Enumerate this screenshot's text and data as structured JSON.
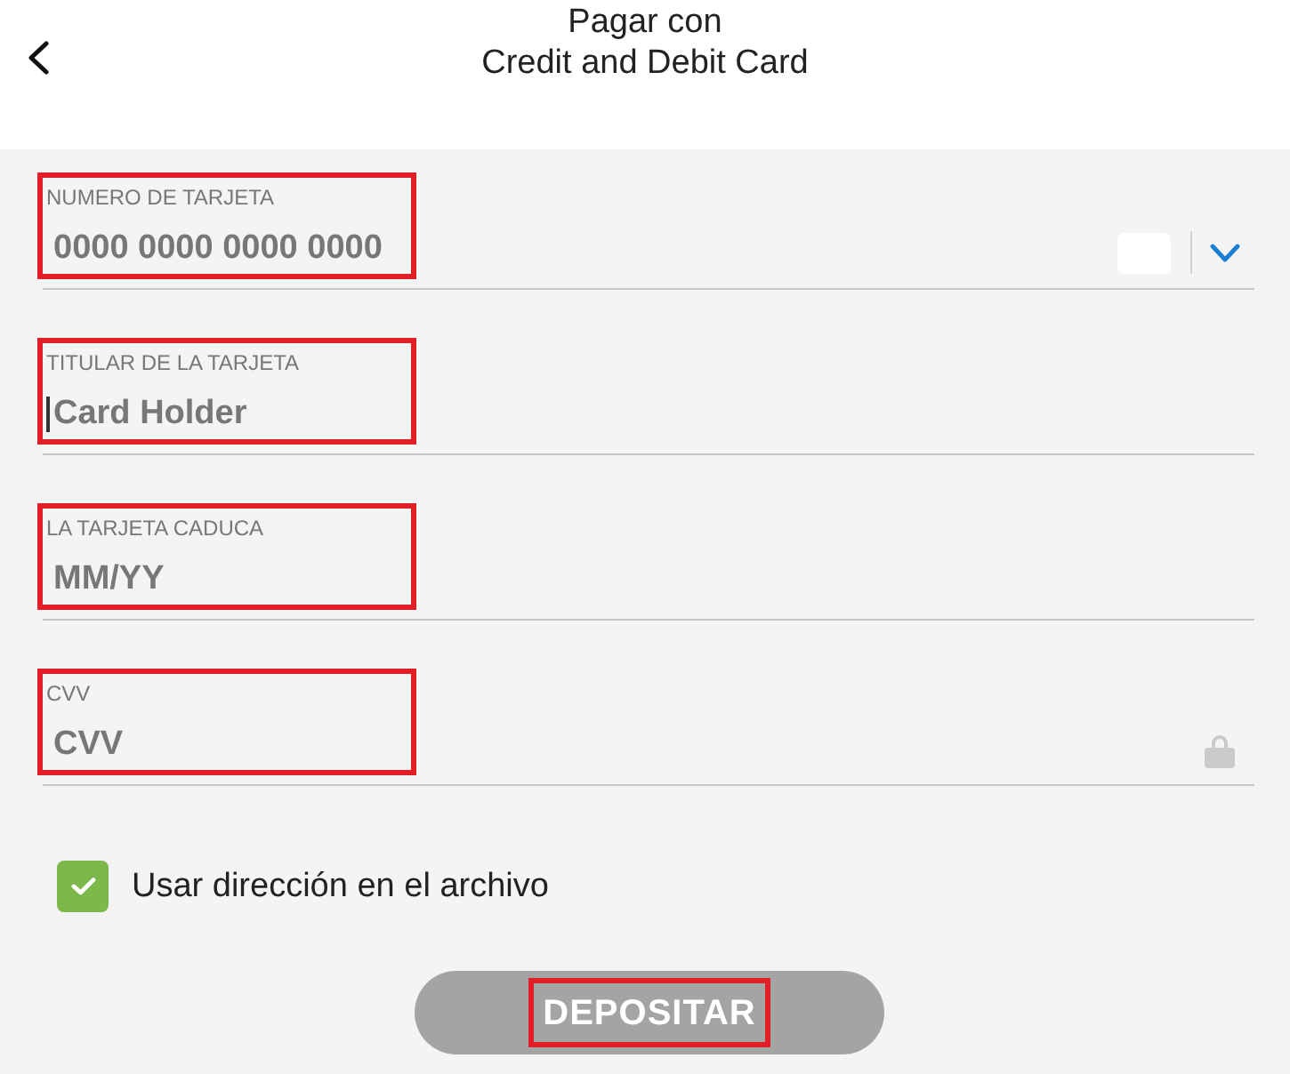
{
  "header": {
    "title": "Pagar con",
    "subtitle": "Credit and Debit Card"
  },
  "fields": [
    {
      "kind": "card_number",
      "label": "NUMERO DE TARJETA",
      "placeholder": "0000 0000 0000 0000",
      "highlighted": true,
      "focused": false
    },
    {
      "kind": "text",
      "label": "TITULAR DE LA TARJETA",
      "placeholder": "Card Holder",
      "highlighted": true,
      "focused": true
    },
    {
      "kind": "text",
      "label": "LA TARJETA CADUCA",
      "placeholder": "MM/YY",
      "highlighted": true,
      "focused": false
    },
    {
      "kind": "cvv",
      "label": "CVV",
      "placeholder": "CVV",
      "highlighted": true,
      "focused": false
    }
  ],
  "address_checkbox": {
    "label": "Usar dirección en el archivo",
    "checked": true
  },
  "submit_button": {
    "label": "DEPOSITAR",
    "disabled": true,
    "highlighted": true
  }
}
